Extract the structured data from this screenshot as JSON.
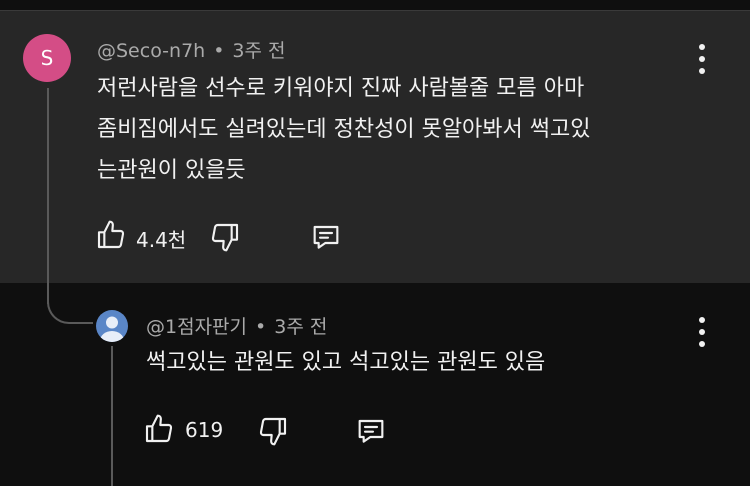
{
  "comment": {
    "avatar_letter": "S",
    "author": "@Seco-n7h",
    "separator": "•",
    "time": "3주 전",
    "lines": [
      "저런사람을 선수로 키워야지 진짜 사람볼줄 모름 아마",
      "좀비짐에서도 실려있는데 정찬성이 못알아봐서 썩고있",
      "는관원이 있을듯"
    ],
    "likes": "4.4천"
  },
  "reply": {
    "author": "@1점자판기",
    "separator": "•",
    "time": "3주 전",
    "text": "썩고있는 관원도 있고 석고있는 관원도 있음",
    "likes": "619"
  },
  "colors": {
    "highlight_bg": "#272727",
    "page_bg": "#0f0f0f",
    "avatar_s": "#d44d86",
    "avatar_user": "#5a86c7"
  },
  "icons": [
    "like-icon",
    "dislike-icon",
    "reply-icon",
    "more-icon"
  ]
}
